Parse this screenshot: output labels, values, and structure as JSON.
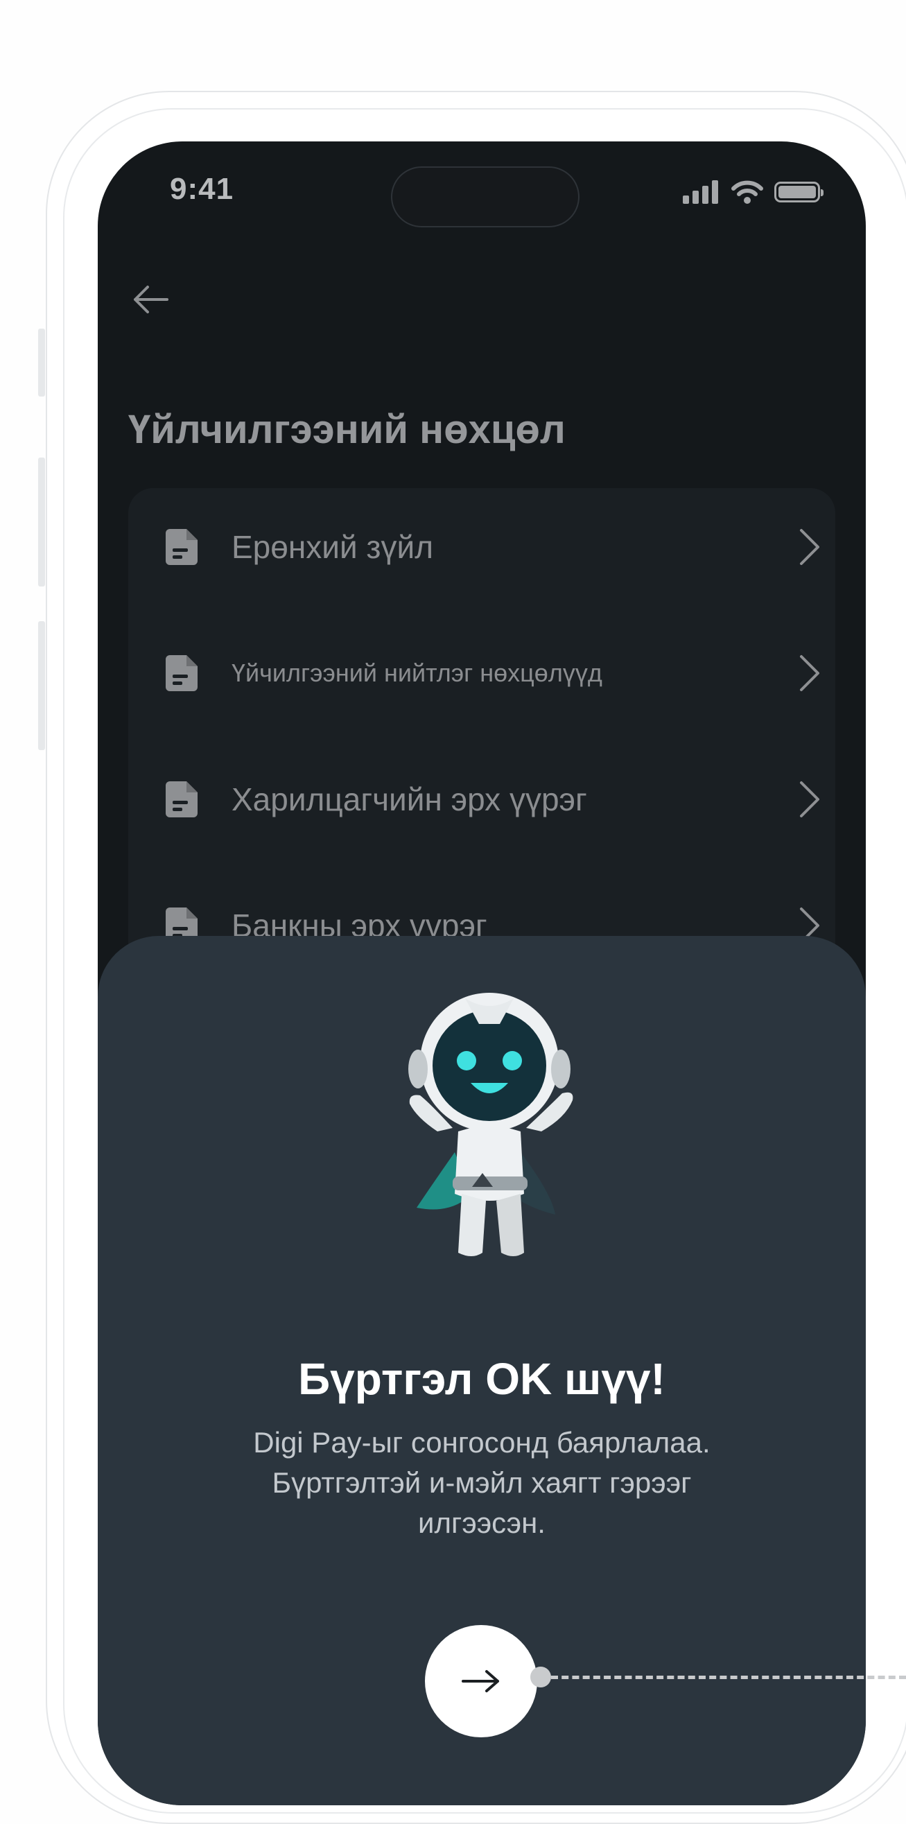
{
  "status_bar": {
    "time": "9:41",
    "icons": [
      "signal-icon",
      "wifi-icon",
      "battery-icon"
    ]
  },
  "header": {
    "back_icon": "arrow-left-icon",
    "title": "Үйлчилгээний нөхцөл"
  },
  "menu": {
    "items": [
      {
        "label": "Ерөнхий зүйл",
        "icon": "document-icon"
      },
      {
        "label": "Үйчилгээний нийтлэг нөхцөлүүд",
        "icon": "document-icon"
      },
      {
        "label": "Харилцагчийн эрх үүрэг",
        "icon": "document-icon"
      },
      {
        "label": "Банкны эрх  үүрэг",
        "icon": "document-icon"
      }
    ]
  },
  "success_sheet": {
    "illustration": "robot-mascot",
    "title": "Бүртгэл OK шүү!",
    "description": "Digi Pay-ыг сонгосонд баярлалаа. Бүртгэлтэй и-мэйл хаягт гэрээг илгээсэн.",
    "next_icon": "arrow-right-icon"
  },
  "colors": {
    "screen_bg": "#14181b",
    "card_bg": "#1a1f23",
    "sheet_bg": "#2b353e",
    "mascot_accent": "#3fe0e0",
    "cape": "#1f8f86"
  }
}
